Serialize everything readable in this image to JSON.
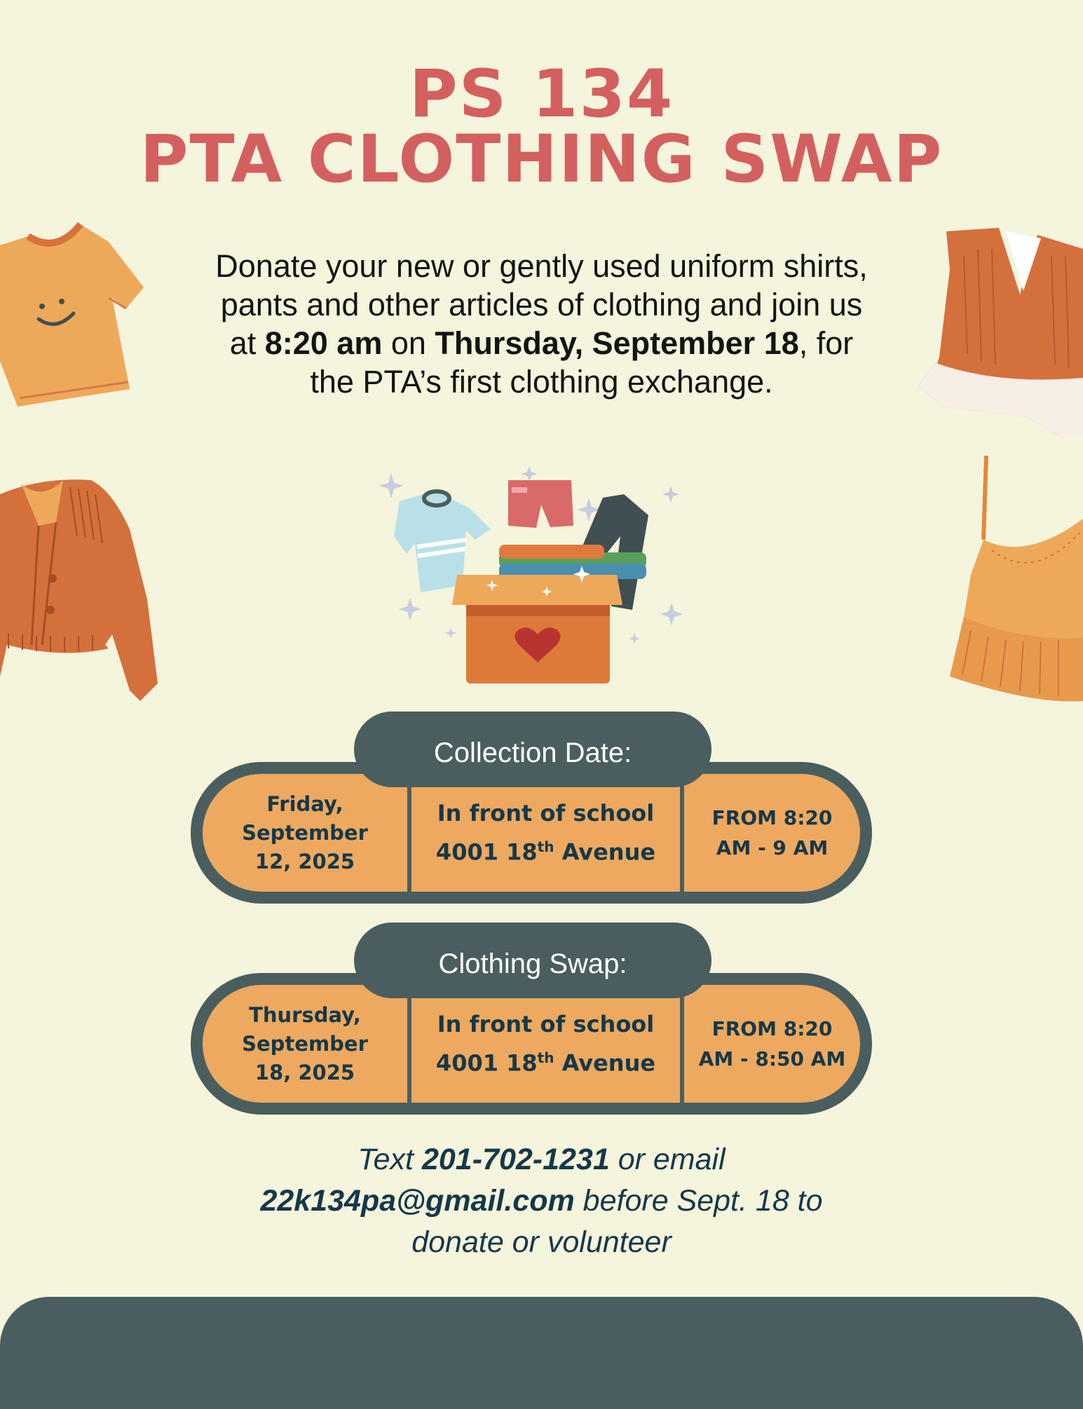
{
  "title": {
    "line1": "PS 134",
    "line2": "PTA CLOTHING SWAP"
  },
  "intro": {
    "part1": "Donate your new or gently used uniform shirts, pants and other articles of clothing and join us at ",
    "time": "8:20 am",
    "part2": " on ",
    "date": "Thursday, September 18",
    "part3": ", for the PTA’s first clothing exchange."
  },
  "collection": {
    "label": "Collection Date:",
    "date_lines": [
      "Friday,",
      "September",
      "12, 2025"
    ],
    "location_line1": "In front of school",
    "location_line2_pre": "4001 18",
    "location_line2_sup": "th",
    "location_line2_post": " Avenue",
    "time_lines": [
      "FROM 8:20",
      "AM - 9 AM"
    ]
  },
  "swap": {
    "label": "Clothing Swap:",
    "date_lines": [
      "Thursday,",
      "September",
      "18, 2025"
    ],
    "location_line1": "In front of school",
    "location_line2_pre": "4001 18",
    "location_line2_sup": "th",
    "location_line2_post": " Avenue",
    "time_lines": [
      "FROM 8:20",
      "AM - 8:50 AM"
    ]
  },
  "contact": {
    "text1": "Text ",
    "phone": "201-702-1231",
    "text2": " or email ",
    "email": "22k134pa@gmail.com",
    "text3": " before Sept. 18 to donate or volunteer"
  },
  "colors": {
    "background": "#f5f4dc",
    "title": "#d45f5f",
    "dark": "#4a5e5f",
    "orange": "#eda95f",
    "navy": "#15384a"
  },
  "icons": [
    "tshirt-icon",
    "cardigan-icon",
    "ruffle-blouse-icon",
    "camisole-icon",
    "donation-box-icon"
  ]
}
